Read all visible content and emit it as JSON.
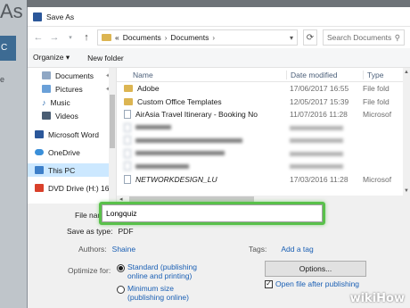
{
  "background": {
    "title_fragment": "As",
    "side_texts": [
      "C",
      "e"
    ]
  },
  "dialog": {
    "title": "Save As",
    "address": {
      "crumb_marker": "«",
      "crumbs": [
        "Documents",
        "Documents"
      ],
      "search_placeholder": "Search Documents"
    },
    "toolbar": {
      "organize_label": "Organize ▾",
      "new_folder_label": "New folder"
    },
    "nav_items": [
      {
        "label": "Documents",
        "icon": "documents-icon",
        "pinned": true
      },
      {
        "label": "Pictures",
        "icon": "pictures-icon",
        "pinned": true
      },
      {
        "label": "Music",
        "icon": "music-icon",
        "pinned": false
      },
      {
        "label": "Videos",
        "icon": "videos-icon",
        "pinned": false
      },
      {
        "label": "Microsoft Word",
        "icon": "word-icon",
        "pinned": false
      },
      {
        "label": "OneDrive",
        "icon": "onedrive-icon",
        "pinned": false
      },
      {
        "label": "This PC",
        "icon": "pc-icon",
        "pinned": false,
        "selected": true
      },
      {
        "label": "DVD Drive (H:) 16.",
        "icon": "dvd-icon",
        "pinned": false
      }
    ],
    "columns": {
      "name": "Name",
      "date": "Date modified",
      "type": "Type"
    },
    "files": [
      {
        "name": "Adobe",
        "date": "17/06/2017 16:55",
        "type": "File fold",
        "kind": "folder"
      },
      {
        "name": "Custom Office Templates",
        "date": "12/05/2017 15:39",
        "type": "File fold",
        "kind": "folder"
      },
      {
        "name": "AirAsia Travel Itinerary - Booking No",
        "date": "11/07/2016 11:28",
        "type": "Microsof",
        "kind": "doc"
      },
      {
        "name": "NETWORKDESIGN_LU",
        "date": "17/03/2016 11:28",
        "type": "Microsof",
        "kind": "doc"
      }
    ],
    "form": {
      "file_name_label": "File name:",
      "file_name_value": "Longquiz",
      "save_type_label": "Save as type:",
      "save_type_value": "PDF",
      "authors_label": "Authors:",
      "authors_value": "Shaine",
      "tags_label": "Tags:",
      "tags_value": "Add a tag",
      "optimize_label": "Optimize for:",
      "opt_standard": "Standard (publishing online and printing)",
      "opt_minimum": "Minimum size (publishing online)",
      "options_button": "Options...",
      "open_after_label": "Open file after publishing",
      "open_after_checked": true
    }
  },
  "watermark": {
    "part1": "wiki",
    "part2": "How"
  }
}
